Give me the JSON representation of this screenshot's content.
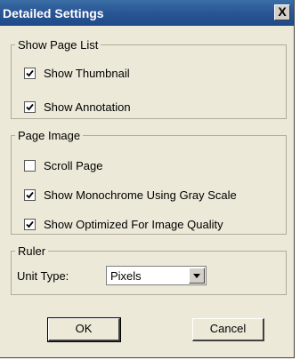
{
  "dialog": {
    "title": "Detailed Settings",
    "close_label": "X"
  },
  "show_page_list": {
    "legend": "Show Page List",
    "items": [
      {
        "label": "Show Thumbnail",
        "checked": true
      },
      {
        "label": "Show Annotation",
        "checked": true
      }
    ]
  },
  "page_image": {
    "legend": "Page Image",
    "items": [
      {
        "label": "Scroll Page",
        "checked": false
      },
      {
        "label": "Show Monochrome Using Gray Scale",
        "checked": true
      },
      {
        "label": "Show Optimized For Image Quality",
        "checked": true
      }
    ]
  },
  "ruler": {
    "legend": "Ruler",
    "unit_type_label": "Unit Type:",
    "unit_type_value": "Pixels"
  },
  "buttons": {
    "ok_label": "OK",
    "cancel_label": "Cancel"
  },
  "colors": {
    "titlebar": "#2b5797",
    "dialog_bg": "#ece9d8"
  }
}
